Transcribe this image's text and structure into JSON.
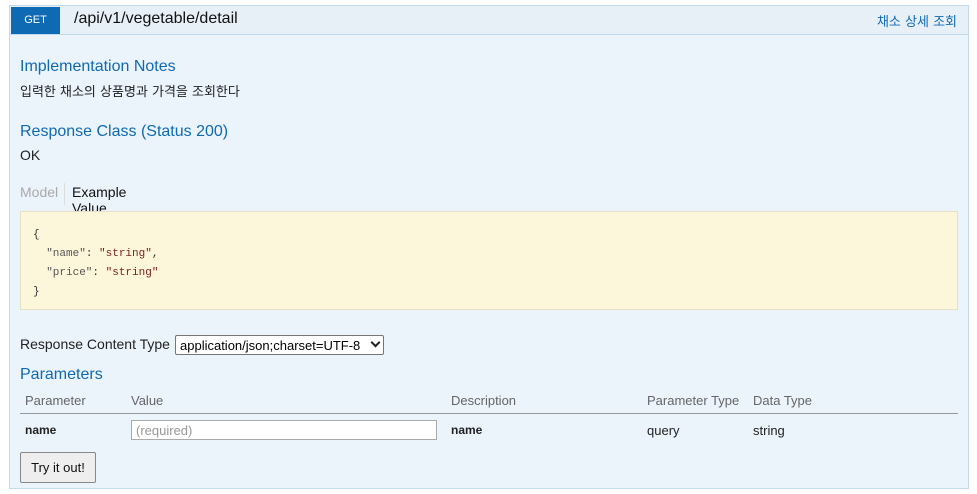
{
  "operation": {
    "method": "GET",
    "path": "/api/v1/vegetable/detail",
    "summary": "채소 상세 조회"
  },
  "implementation_notes": {
    "heading": "Implementation Notes",
    "text": "입력한 채소의 상품명과 가격을 조회한다"
  },
  "response_class": {
    "heading": "Response Class (Status 200)",
    "text": "OK"
  },
  "model_tabs": {
    "model": "Model",
    "example": "Example Value"
  },
  "example_json": {
    "open": "{",
    "lines": [
      {
        "key": "\"name\"",
        "value": "\"string\"",
        "trail": ","
      },
      {
        "key": "\"price\"",
        "value": "\"string\"",
        "trail": ""
      }
    ],
    "close": "}"
  },
  "response_content_type": {
    "label": "Response Content Type",
    "selected": "application/json;charset=UTF-8"
  },
  "parameters": {
    "heading": "Parameters",
    "columns": [
      "Parameter",
      "Value",
      "Description",
      "Parameter Type",
      "Data Type"
    ],
    "rows": [
      {
        "name": "name",
        "placeholder": "(required)",
        "description": "name",
        "param_type": "query",
        "data_type": "string"
      }
    ]
  },
  "try_button": "Try it out!",
  "colors": {
    "accent": "#0f6ab4",
    "panel": "#ebf3fb",
    "code_bg": "#fcf6db"
  }
}
